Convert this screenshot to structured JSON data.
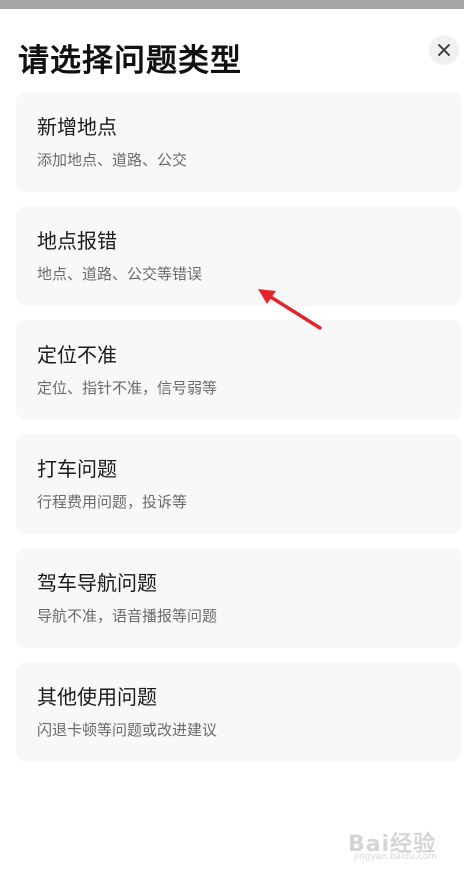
{
  "sheet": {
    "title": "请选择问题类型",
    "close_icon": "close-icon"
  },
  "items": [
    {
      "title": "新增地点",
      "subtitle": "添加地点、道路、公交"
    },
    {
      "title": "地点报错",
      "subtitle": "地点、道路、公交等错误"
    },
    {
      "title": "定位不准",
      "subtitle": "定位、指针不准，信号弱等"
    },
    {
      "title": "打车问题",
      "subtitle": "行程费用问题，投诉等"
    },
    {
      "title": "驾车导航问题",
      "subtitle": "导航不准，语音播报等问题"
    },
    {
      "title": "其他使用问题",
      "subtitle": "闪退卡顿等问题或改进建议"
    }
  ],
  "annotation": {
    "arrow_color": "#e0262b"
  },
  "watermark": {
    "text": "Bai经验",
    "sub": "jingyan.baidu.com"
  },
  "colors": {
    "card_bg": "#f8f8f8",
    "title": "#111111",
    "subtitle": "#6a6a6a"
  }
}
